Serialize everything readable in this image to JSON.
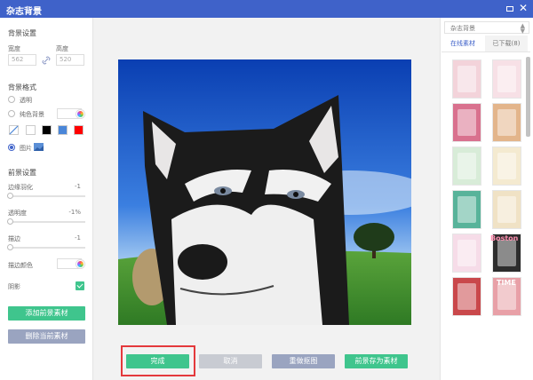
{
  "window": {
    "title": "杂志背景"
  },
  "left": {
    "bg_settings_title": "背景设置",
    "width_label": "宽度",
    "height_label": "高度",
    "width_value": "562",
    "height_value": "520",
    "bg_format_title": "背景格式",
    "option_transparent": "透明",
    "option_solid": "纯色背景",
    "option_image": "图片",
    "fg_settings_title": "前景设置",
    "feather_label": "边缘羽化",
    "feather_value": "-1",
    "opacity_label": "透明度",
    "opacity_value": "-1%",
    "stroke_label": "描边",
    "stroke_value": "-1",
    "stroke_color_label": "描边颜色",
    "shadow_label": "阴影",
    "add_fg_button": "添加前景素材",
    "delete_fg_button": "删除当前素材"
  },
  "swatches": [
    "#ffffff",
    "#000000",
    "#4a86d8",
    "#ff0000"
  ],
  "bottom": {
    "done_button": "完成",
    "cancel_button": "取消",
    "recrop_button": "重做抠图",
    "save_fg_button": "前景存为素材"
  },
  "right": {
    "dropdown_value": "杂志背景",
    "tab_online": "在线素材",
    "tab_downloaded": "已下载(8)",
    "thumbnails": [
      {
        "caption": "pink-floral-card",
        "bg": "#f3d3da"
      },
      {
        "caption": "ice-cream-card",
        "bg": "#f7e0e6"
      },
      {
        "caption": "pink-frame",
        "bg": "#d9718e"
      },
      {
        "caption": "brown-parchment",
        "bg": "#e3b58b"
      },
      {
        "caption": "green-leaf-frame",
        "bg": "#d8ecd8"
      },
      {
        "caption": "floral-oval",
        "bg": "#f4ead0"
      },
      {
        "caption": "teal-frame",
        "bg": "#58b39a"
      },
      {
        "caption": "floral-parchment",
        "bg": "#f0e2c5"
      },
      {
        "caption": "pink-floral-frame",
        "bg": "#f6dce8"
      },
      {
        "caption": "boston-heart",
        "bg": "#2d2d2d"
      },
      {
        "caption": "red-photo-frame",
        "bg": "#c9484b"
      },
      {
        "caption": "time-magazine",
        "bg": "#e8a0a7"
      }
    ],
    "thumb_texts": [
      "Boston",
      "TIME"
    ]
  }
}
